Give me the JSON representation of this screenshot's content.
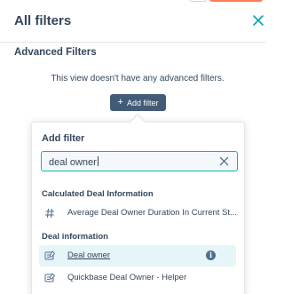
{
  "panel": {
    "title": "All filters",
    "close_icon": "close-icon"
  },
  "advanced": {
    "title": "Advanced Filters",
    "empty_text": "This view doesn't have any advanced filters.",
    "add_filter_label": "Add filter"
  },
  "dropdown": {
    "title": "Add filter",
    "search_value": "deal owner",
    "groups": [
      {
        "label": "Calculated Deal Information",
        "options": [
          {
            "label": "Average Deal Owner Duration In Current St...",
            "icon": "hash-icon"
          }
        ]
      },
      {
        "label": "Deal information",
        "options": [
          {
            "label": "Deal owner",
            "icon": "owner-property-icon",
            "highlighted": true
          },
          {
            "label": "Quickbase Deal Owner - Helper",
            "icon": "owner-property-icon"
          }
        ]
      }
    ]
  },
  "colors": {
    "accent_teal": "#00bda5",
    "button_dark": "#425b76",
    "highlight_bg": "#e5f5f8",
    "text": "#33475b"
  }
}
